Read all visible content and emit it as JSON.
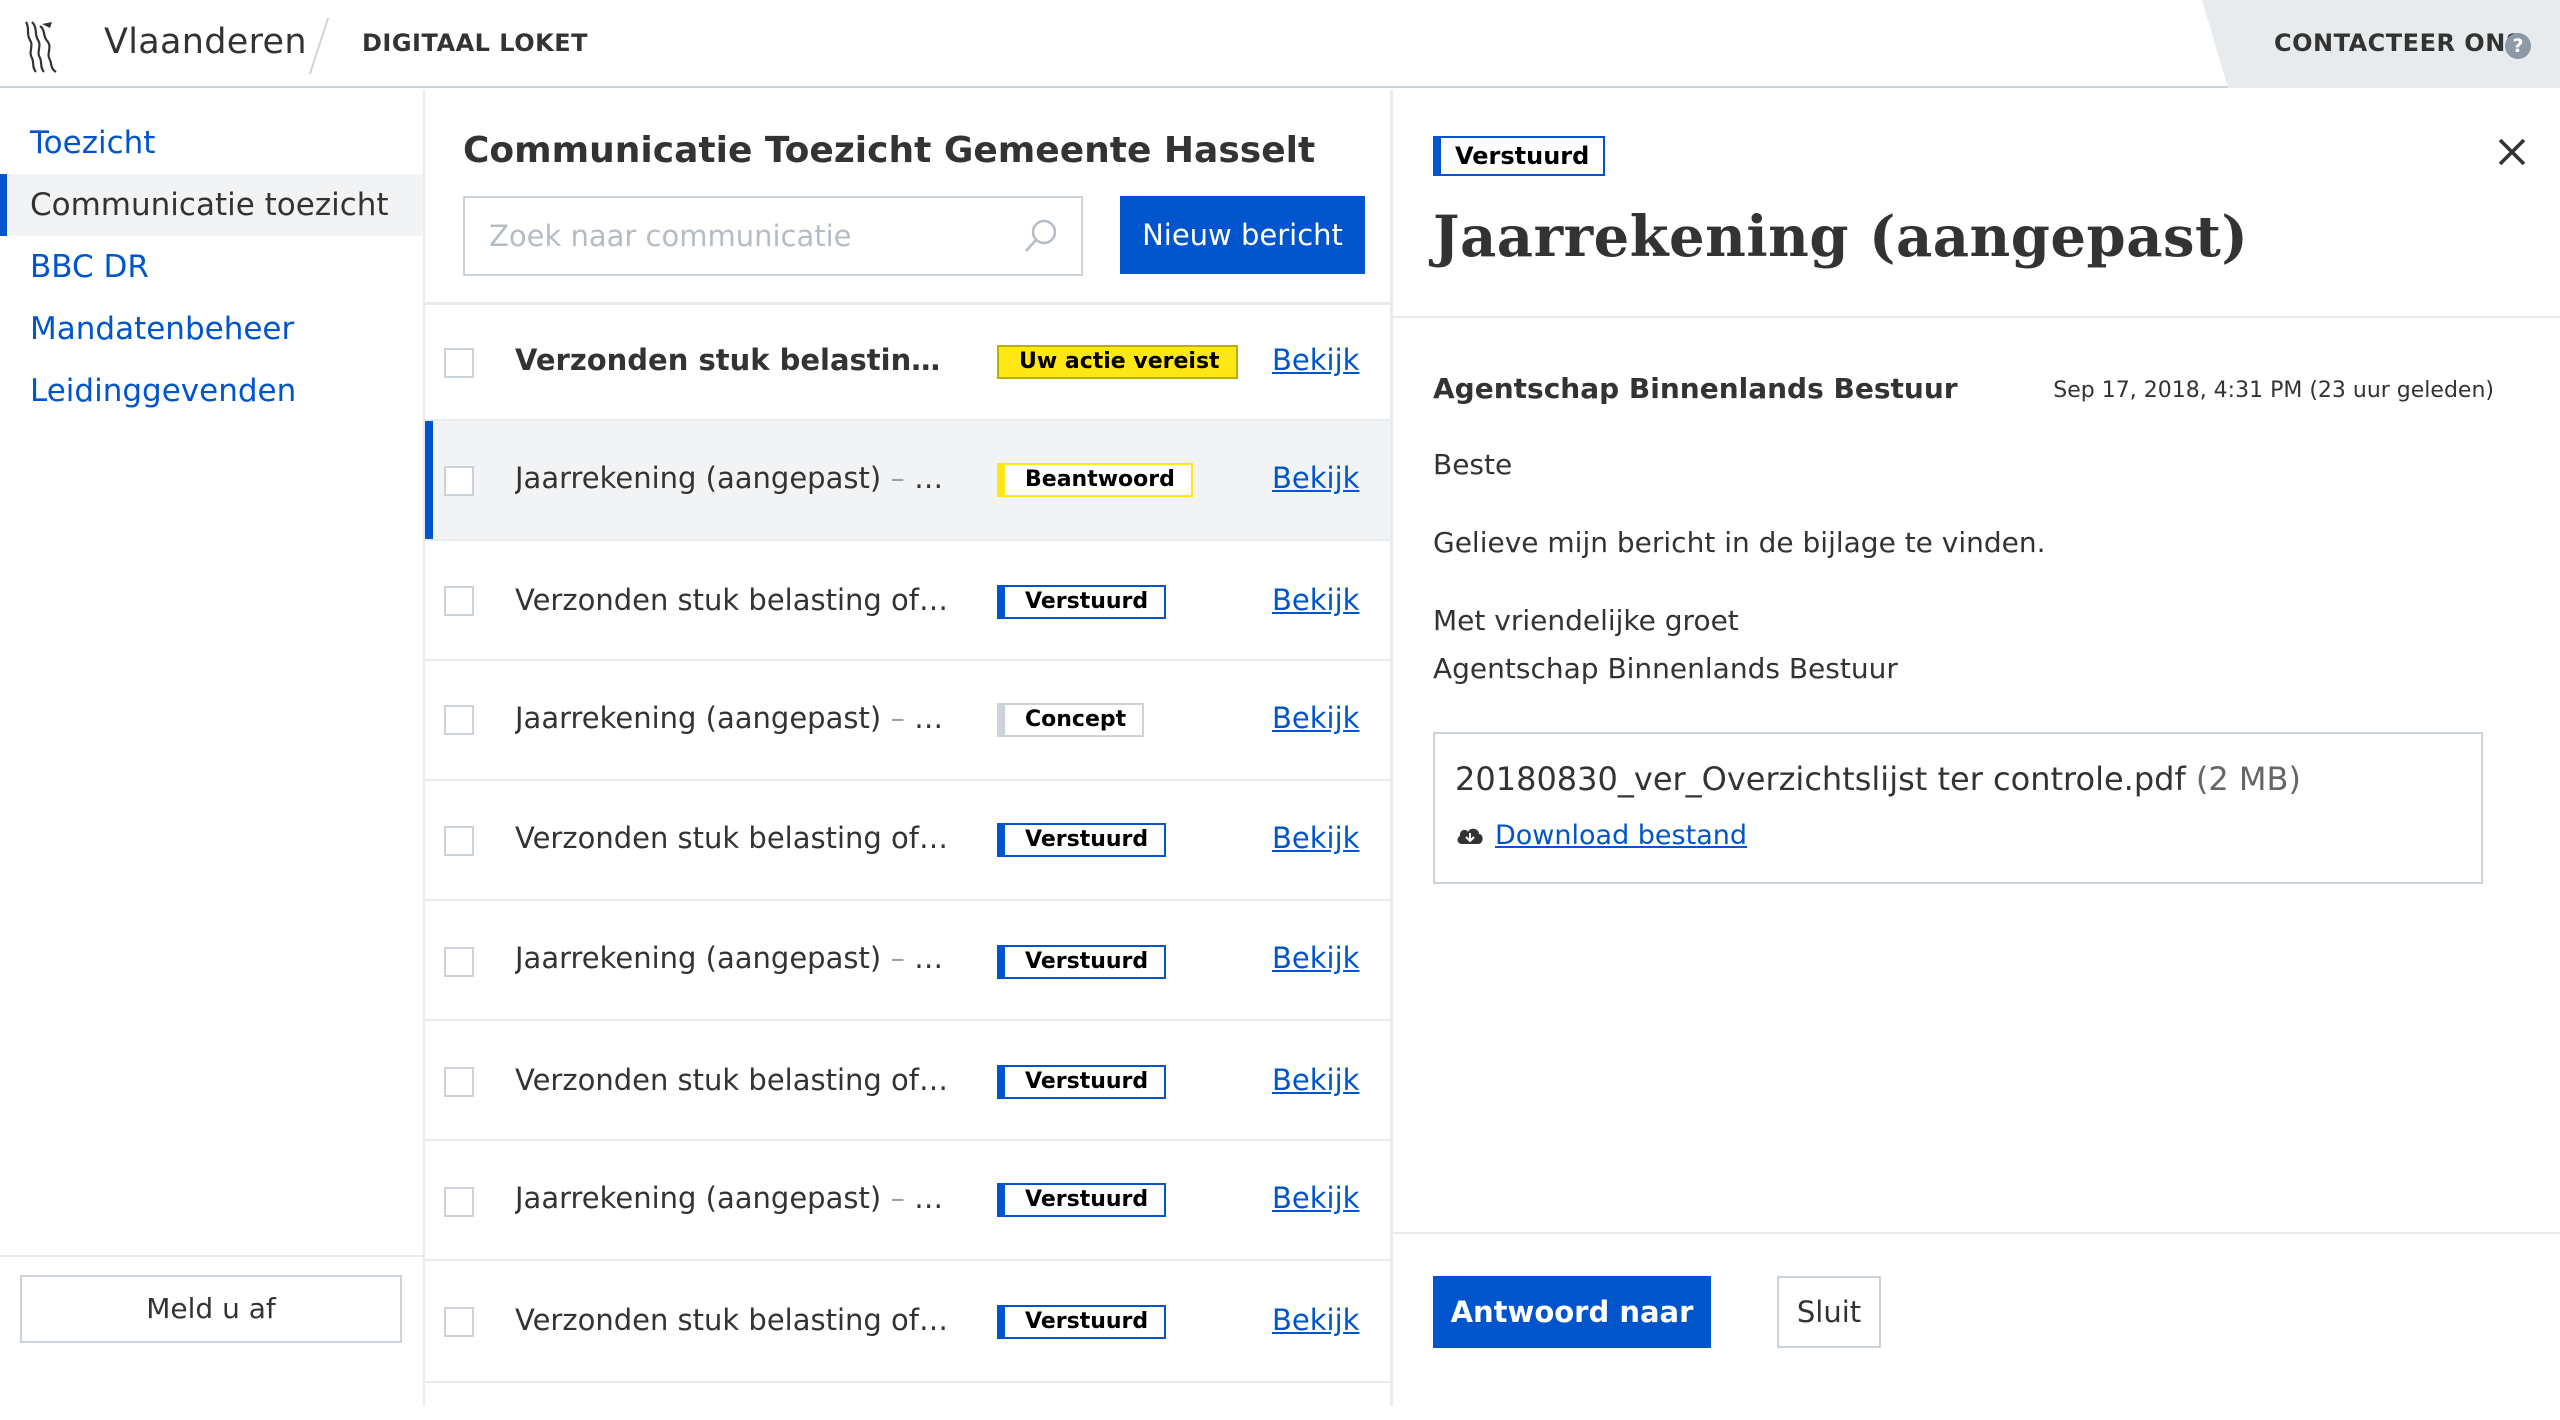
{
  "header": {
    "brand": "Vlaanderen",
    "subtitle": "DIGITAAL LOKET",
    "contact_label": "CONTACTEER ONS",
    "help_glyph": "?"
  },
  "sidebar": {
    "items": [
      {
        "label": "Toezicht",
        "active": false
      },
      {
        "label": "Communicatie toezicht",
        "active": true
      },
      {
        "label": "BBC DR",
        "active": false
      },
      {
        "label": "Mandatenbeheer",
        "active": false
      },
      {
        "label": "Leidinggevenden",
        "active": false
      }
    ],
    "logout_label": "Meld u af"
  },
  "list": {
    "title": "Communicatie Toezicht Gemeente Hasselt",
    "search_placeholder": "Zoek naar communicatie",
    "new_button": "Nieuw bericht",
    "rows": [
      {
        "subject": "Verzonden stuk belasting of ...",
        "extra": "",
        "status": "Uw actie vereist",
        "link": "Bekijk"
      },
      {
        "subject": "Jaarrekening (aangepast)",
        "extra": " – Af...",
        "status": "Beantwoord",
        "link": "Bekijk"
      },
      {
        "subject": "Verzonden stuk belasting of re...",
        "extra": "",
        "status": "Verstuurd",
        "link": "Bekijk"
      },
      {
        "subject": "Jaarrekening (aangepast)",
        "extra": " – Af...",
        "status": "Concept",
        "link": "Bekijk"
      },
      {
        "subject": "Verzonden stuk belasting of r...",
        "extra": "",
        "status": "Verstuurd",
        "link": "Bekijk"
      },
      {
        "subject": "Jaarrekening (aangepast)",
        "extra": " – Af...",
        "status": "Verstuurd",
        "link": "Bekijk"
      },
      {
        "subject": "Verzonden stuk belasting of r...",
        "extra": "",
        "status": "Verstuurd",
        "link": "Bekijk"
      },
      {
        "subject": "Jaarrekening (aangepast)",
        "extra": " – Af...",
        "status": "Verstuurd",
        "link": "Bekijk"
      },
      {
        "subject": "Verzonden stuk belasting of r...",
        "extra": "",
        "status": "Verstuurd",
        "link": "Bekijk"
      }
    ]
  },
  "detail": {
    "status": "Verstuurd",
    "title": "Jaarrekening (aangepast)",
    "sender": "Agentschap Binnenlands Bestuur",
    "timestamp": "Sep 17, 2018, 4:31 PM (23 uur geleden)",
    "body": {
      "greeting": "Beste",
      "text": "Gelieve mijn bericht in de bijlage te vinden.",
      "closing": "Met vriendelijke groet",
      "signature": "Agentschap Binnenlands Bestuur"
    },
    "attachment": {
      "filename": "20180830_ver_Overzichtslijst ter controle.pdf",
      "size": "(2 MB)",
      "download_label": "Download bestand"
    },
    "reply_button": "Antwoord naar ABB",
    "close_button": "Sluit"
  },
  "colors": {
    "primary": "#0055cc",
    "action_required": "#ffe615",
    "border": "#cbd2da"
  },
  "icons": [
    "lion-logo-icon",
    "help-icon",
    "search-icon",
    "close-icon",
    "cloud-download-icon"
  ]
}
